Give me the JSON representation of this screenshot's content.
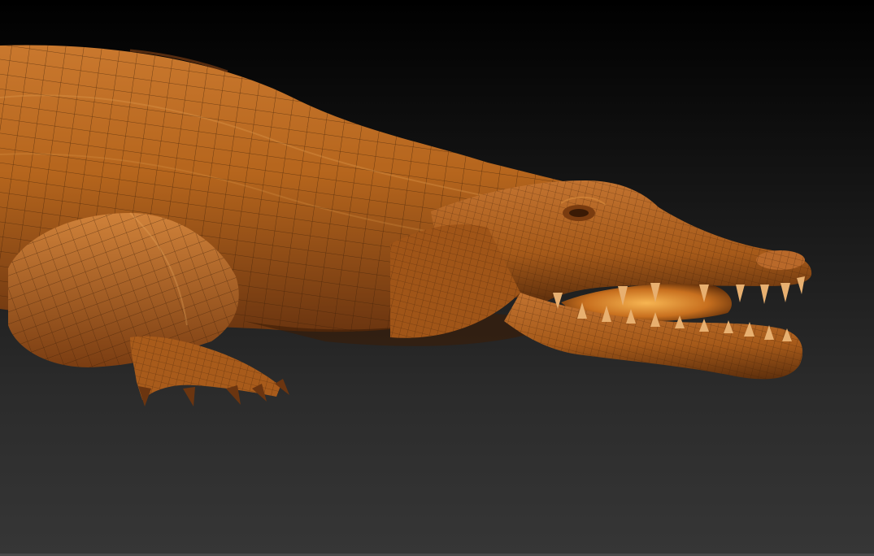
{
  "viewport": {
    "background_top": "#000000",
    "background_bottom": "#363636",
    "model": {
      "subject": "crocodile",
      "icon": "crocodile-mesh-render",
      "material_color": "#b5651d",
      "material_highlight": "#d98a3a",
      "material_shadow": "#5a2e0a",
      "wire_color": "#3a1d06",
      "mouth_interior": "#f0a040",
      "display_mode": "polyframe"
    }
  }
}
